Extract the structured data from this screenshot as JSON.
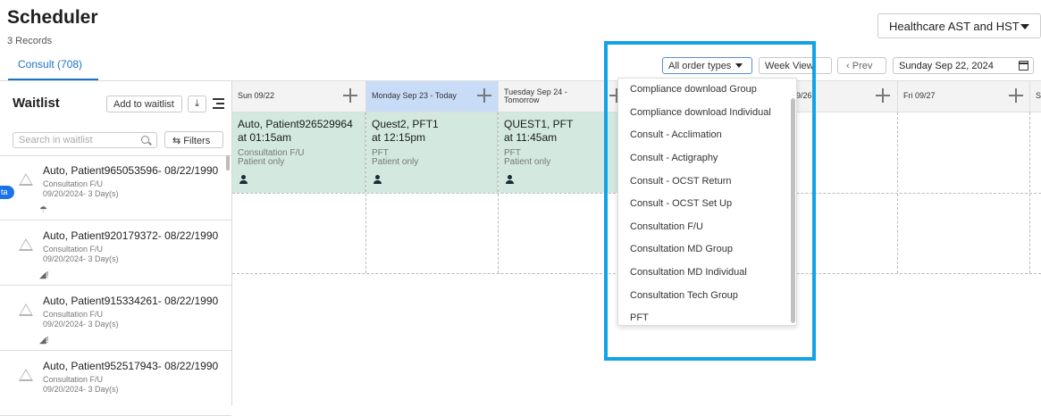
{
  "header": {
    "title": "Scheduler",
    "records": "3 Records",
    "tab_label": "Consult (708)",
    "org_select": "Healthcare AST and HST"
  },
  "toolbar": {
    "order_types": "All order types",
    "view": "Week View",
    "prev": "Prev",
    "date": "Sunday Sep 22, 2024"
  },
  "waitlist": {
    "title": "Waitlist",
    "add_label": "Add to waitlist",
    "search_placeholder": "Search in waitlist",
    "filters_label": "Filters",
    "badge": "ta",
    "items": [
      {
        "name": "Auto, Patient965053596- 08/22/1990",
        "type": "Consultation F/U",
        "date": "09/20/2024- 3 Day(s)",
        "icon": "umbrella-icon"
      },
      {
        "name": "Auto, Patient920179372- 08/22/1990",
        "type": "Consultation F/U",
        "date": "09/20/2024- 3 Day(s)",
        "icon": "alert-icon"
      },
      {
        "name": "Auto, Patient915334261- 08/22/1990",
        "type": "Consultation F/U",
        "date": "09/20/2024- 3 Day(s)",
        "icon": "alert-icon"
      },
      {
        "name": "Auto, Patient952517943- 08/22/1990",
        "type": "Consultation F/U",
        "date": "09/20/2024- 3 Day(s)",
        "icon": "alert-icon"
      }
    ]
  },
  "calendar": {
    "days": [
      {
        "label": "Sun 09/22"
      },
      {
        "label": "Monday Sep 23 - Today"
      },
      {
        "label": "Tuesday Sep 24 -",
        "sub": "Tomorrow"
      },
      {
        "label": "Thu 09/26"
      },
      {
        "label": "Fri 09/27"
      },
      {
        "label": "S"
      }
    ],
    "appointments": [
      {
        "name": "Auto, Patient926529964",
        "time": "at 01:15am",
        "type": "Consultation F/U",
        "mode": "Patient only"
      },
      {
        "name": "Quest2, PFT1",
        "time": "at 12:15pm",
        "type": "PFT",
        "mode": "Patient only"
      },
      {
        "name": "QUEST1, PFT",
        "time": "at 11:45am",
        "type": "PFT",
        "mode": "Patient only"
      }
    ]
  },
  "dropdown": {
    "options": [
      "Compliance download Group",
      "Compliance download Individual",
      "Consult - Acclimation",
      "Consult - Actigraphy",
      "Consult - OCST Return",
      "Consult - OCST Set Up",
      "Consultation F/U",
      "Consultation MD Group",
      "Consultation MD Individual",
      "Consultation Tech Group",
      "PFT"
    ]
  },
  "colors": {
    "accent": "#1a73c7",
    "today_header": "#c9dcf7",
    "appointment": "#d3e9e0",
    "highlight": "#12a3e6"
  }
}
